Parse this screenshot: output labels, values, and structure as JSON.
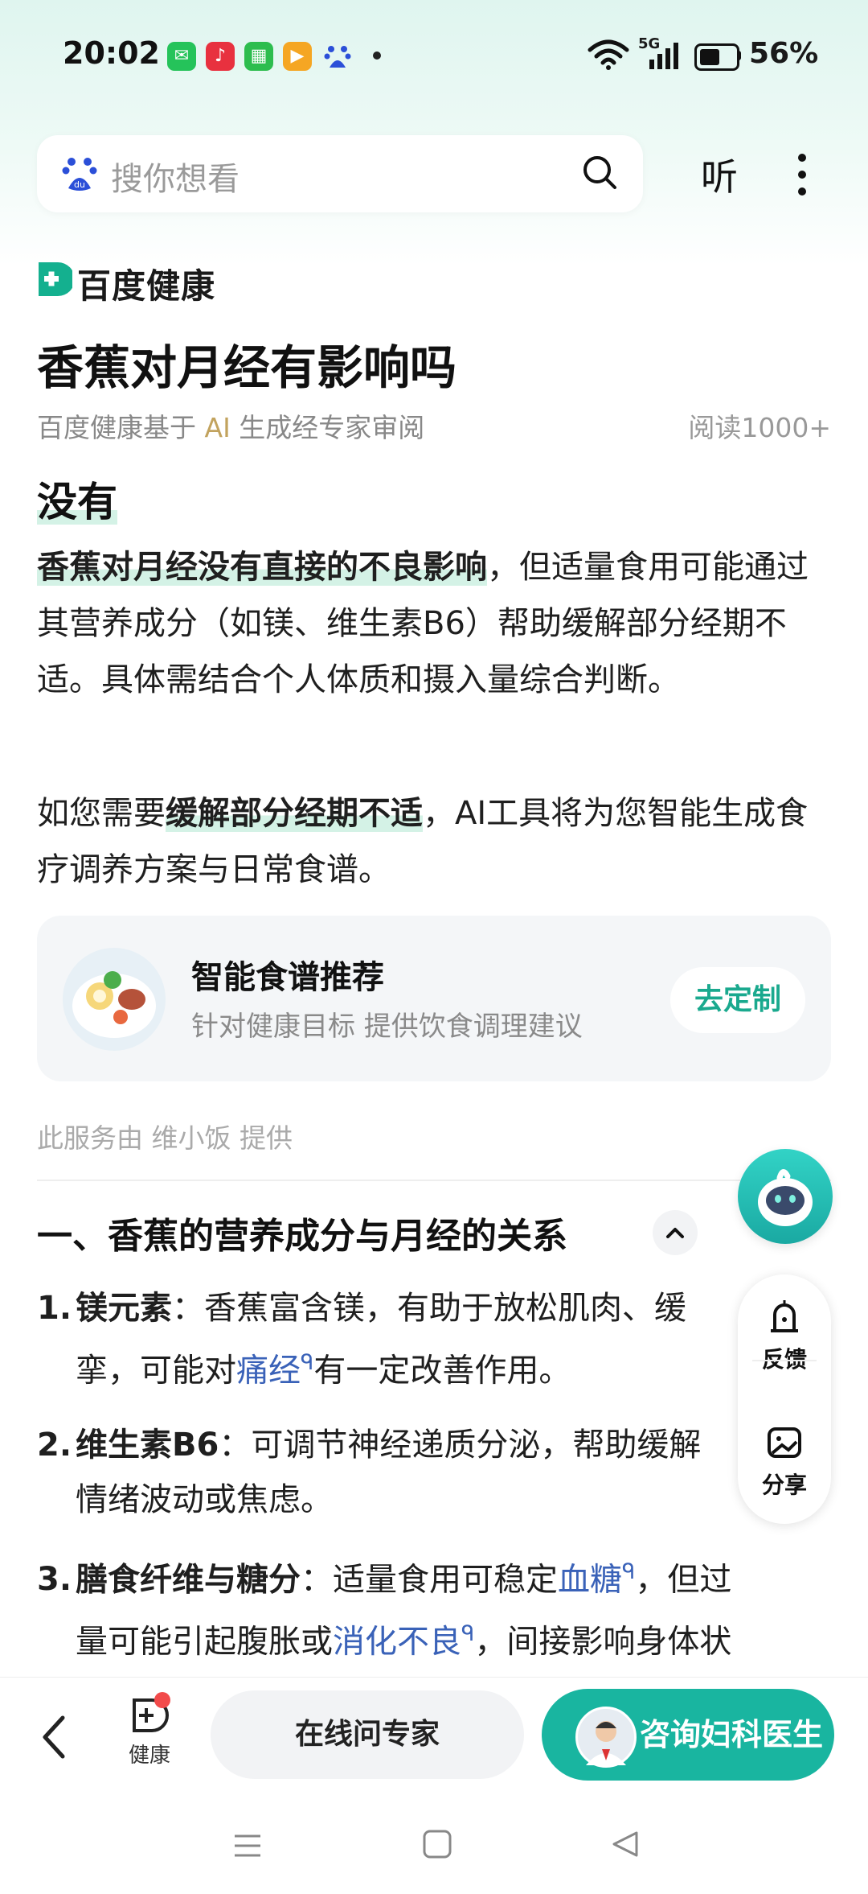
{
  "status_bar": {
    "time": "20:02",
    "network": "5G",
    "battery": "56%",
    "battery_level": 0.56
  },
  "search": {
    "placeholder": "搜你想看",
    "listen_label": "听"
  },
  "brand": {
    "name": "百度健康"
  },
  "article": {
    "title": "香蕉对月经有影响吗",
    "review_prefix": "百度健康基于 ",
    "review_ai": "AI",
    "review_suffix": " 生成经专家审阅",
    "reads": "阅读1000+",
    "answer": "没有",
    "summary_bold": "香蕉对月经没有直接的不良影响",
    "summary_rest": "，但适量食用可能通过其营养成分（如镁、维生素B6）帮助缓解部分经期不适。具体需结合个人体质和摄入量综合判断。",
    "tool_prefix": "如您需要",
    "tool_bold": "缓解部分经期不适",
    "tool_rest": "，AI工具将为您智能生成食疗调养方案与日常食谱。"
  },
  "recipe_card": {
    "title": "智能食谱推荐",
    "subtitle": "针对健康目标 提供饮食调理建议",
    "button": "去定制"
  },
  "provider": "此服务由 维小饭 提供",
  "section": {
    "title": "一、香蕉的营养成分与月经的关系",
    "items": [
      {
        "num": "1.",
        "term": "镁元素",
        "l1": "：香蕉富含镁，有助于放松肌肉、缓",
        "l2a": "挛，可能对",
        "link": "痛经",
        "l2b": "有一定改善作用。"
      },
      {
        "num": "2.",
        "term": "维生素B6",
        "l1": "：可调节神经递质分泌，帮助缓解",
        "l2": "情绪波动或焦虑。"
      },
      {
        "num": "3.",
        "term": "膳食纤维与糖分",
        "l1a": "：适量食用可稳定",
        "link1": "血糖",
        "l1b": "，但过",
        "l2a": "量可能引起腹胀或",
        "link2": "消化不良",
        "l2b": "，间接影响身体状"
      }
    ]
  },
  "side_actions": {
    "feedback": "反馈",
    "share": "分享"
  },
  "bottom_bar": {
    "health_label": "健康",
    "ask_expert": "在线问专家",
    "consult": "咨询妇科医生"
  },
  "colors": {
    "accent": "#19b5a0",
    "link": "#3a62b8",
    "highlight": "#d4f2e6"
  }
}
